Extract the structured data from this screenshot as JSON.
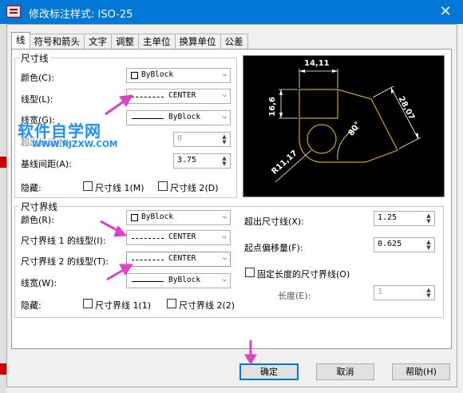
{
  "window": {
    "title": "修改标注样式: ISO-25",
    "close_glyph": "✕"
  },
  "tabs": [
    "线",
    "符号和箭头",
    "文字",
    "调整",
    "主单位",
    "换算单位",
    "公差"
  ],
  "dimension_lines": {
    "legend": "尺寸线",
    "color_label": "颜色(C):",
    "color_value": "ByBlock",
    "linetype_label": "线型(L):",
    "linetype_value": "CENTER",
    "lineweight_label": "线宽(G):",
    "lineweight_value": "ByBlock",
    "extend_label": "超出标记(N):",
    "extend_value": "0",
    "baseline_label": "基线间距(A):",
    "baseline_value": "3.75",
    "suppress_label": "隐藏:",
    "suppress_1": "尺寸线 1(M)",
    "suppress_2": "尺寸线 2(D)"
  },
  "extension_lines": {
    "legend": "尺寸界线",
    "color_label": "颜色(R):",
    "color_value": "ByBlock",
    "linetype1_label": "尺寸界线 1 的线型(I):",
    "linetype1_value": "CENTER",
    "linetype2_label": "尺寸界线 2 的线型(T):",
    "linetype2_value": "CENTER",
    "lineweight_label": "线宽(W):",
    "lineweight_value": "ByBlock",
    "suppress_label": "隐藏:",
    "suppress_1": "尺寸界线 1(1)",
    "suppress_2": "尺寸界线 2(2)",
    "extend_label": "超出尺寸线(X):",
    "extend_value": "1.25",
    "offset_label": "起点偏移量(F):",
    "offset_value": "0.625",
    "fixed_label": "固定长度的尺寸界线(O)",
    "length_label": "长度(E):",
    "length_value": "1"
  },
  "preview": {
    "dim_top": "14,11",
    "dim_left": "16,6",
    "dim_right": "28,07",
    "dim_angle": "80°",
    "dim_radius": "R11,17"
  },
  "watermark": {
    "text": "软件自学网",
    "url": "WWW.RJZXW.COM"
  },
  "buttons": {
    "ok": "确定",
    "cancel": "取消",
    "help": "帮助(H)"
  },
  "colors": {
    "titlebar": "#0078d7",
    "preview_line": "#d4a017",
    "arrow": "#e040c8",
    "watermark": "#1e90ff"
  }
}
